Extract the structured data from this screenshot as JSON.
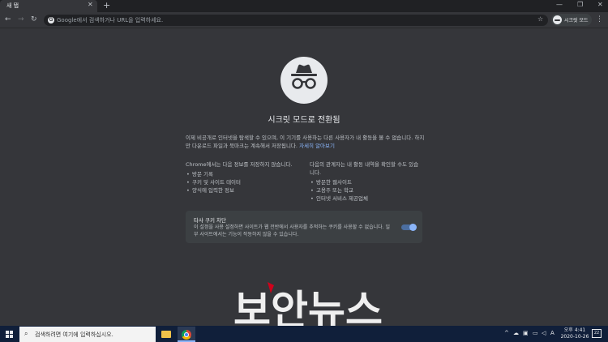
{
  "browser": {
    "tab_title": "새 탭",
    "tab_close": "✕",
    "new_tab": "+",
    "window_minimize": "—",
    "window_restore": "❐",
    "window_close": "✕",
    "omnibox_placeholder": "Google에서 검색하거나 URL을 입력하세요.",
    "profile_label": "시크릿 모드",
    "menu": "⋮"
  },
  "incognito": {
    "title": "시크릿 모드로 전환됨",
    "intro_text": "이제 비공개로 인터넷을 탐색할 수 있으며, 이 기기를 사용하는 다른 사용자가 내 활동을 볼 수 없습니다. 하지만 다운로드 파일과 북마크는 계속해서 저장됩니다.",
    "learn_more": "자세히 알아보기",
    "left_heading": "Chrome에서는 다음 정보를 저장하지 않습니다.",
    "left_items": [
      "방문 기록",
      "쿠키 및 사이트 데이터",
      "양식에 입력한 정보"
    ],
    "right_heading": "다음의 관계자는 내 활동 내역을 확인할 수도 있습니다.",
    "right_items": [
      "방문한 웹사이트",
      "고용주 또는 학교",
      "인터넷 서비스 제공업체"
    ],
    "cookie_title": "타사 쿠키 차단",
    "cookie_desc": "이 설정을 사용 설정하면 사이트가 웹 전반에서 사용자를 추적하는 쿠키를 사용할 수 없습니다. 일부 사이트에서는 기능이 작동하지 않을 수 있습니다.",
    "cookie_toggle_on": true
  },
  "watermark": "보안뉴스",
  "taskbar": {
    "search_placeholder": "검색하려면 여기에 입력하십시오.",
    "clock_time": "오후 4:41",
    "clock_date": "2020-10-26",
    "ime": "A",
    "notifications": "22"
  },
  "colors": {
    "background": "#35363a",
    "accent": "#8ab4f8",
    "taskbar": "#101f3a"
  }
}
